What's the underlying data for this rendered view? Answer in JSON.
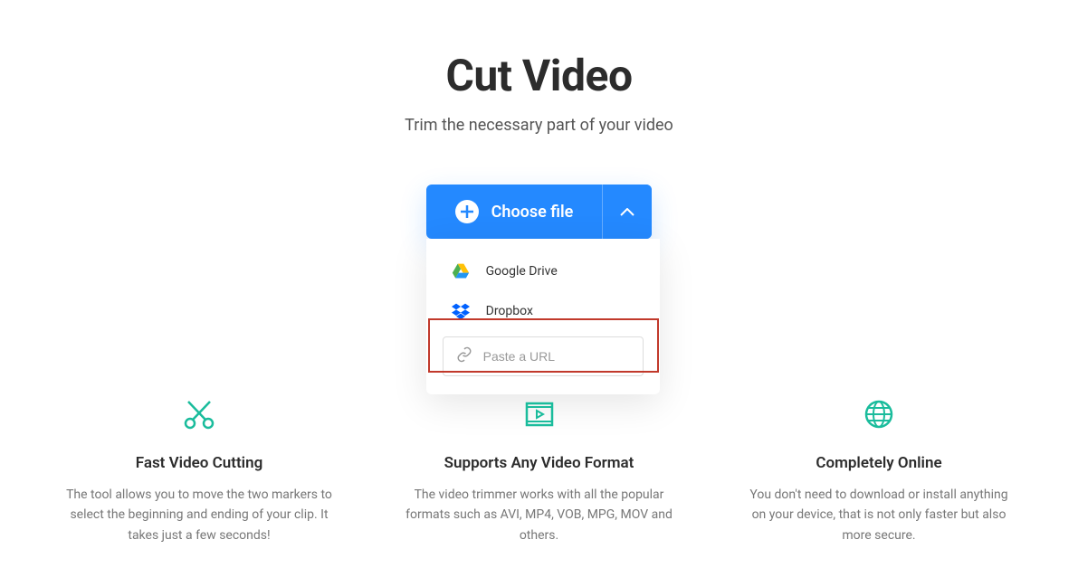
{
  "header": {
    "title": "Cut Video",
    "subtitle": "Trim the necessary part of your video"
  },
  "upload": {
    "choose_label": "Choose file",
    "options": {
      "google_drive": "Google Drive",
      "dropbox": "Dropbox"
    },
    "url_placeholder": "Paste a URL"
  },
  "features": [
    {
      "title": "Fast Video Cutting",
      "desc": "The tool allows you to move the two markers to select the beginning and ending of your clip. It takes just a few seconds!"
    },
    {
      "title": "Supports Any Video Format",
      "desc": "The video trimmer works with all the popular formats such as AVI, MP4, VOB, MPG, MOV and others."
    },
    {
      "title": "Completely Online",
      "desc": "You don't need to download or install anything on your device, that is not only faster but also more secure."
    }
  ],
  "colors": {
    "primary": "#2489ff",
    "teal": "#1abc9c"
  }
}
